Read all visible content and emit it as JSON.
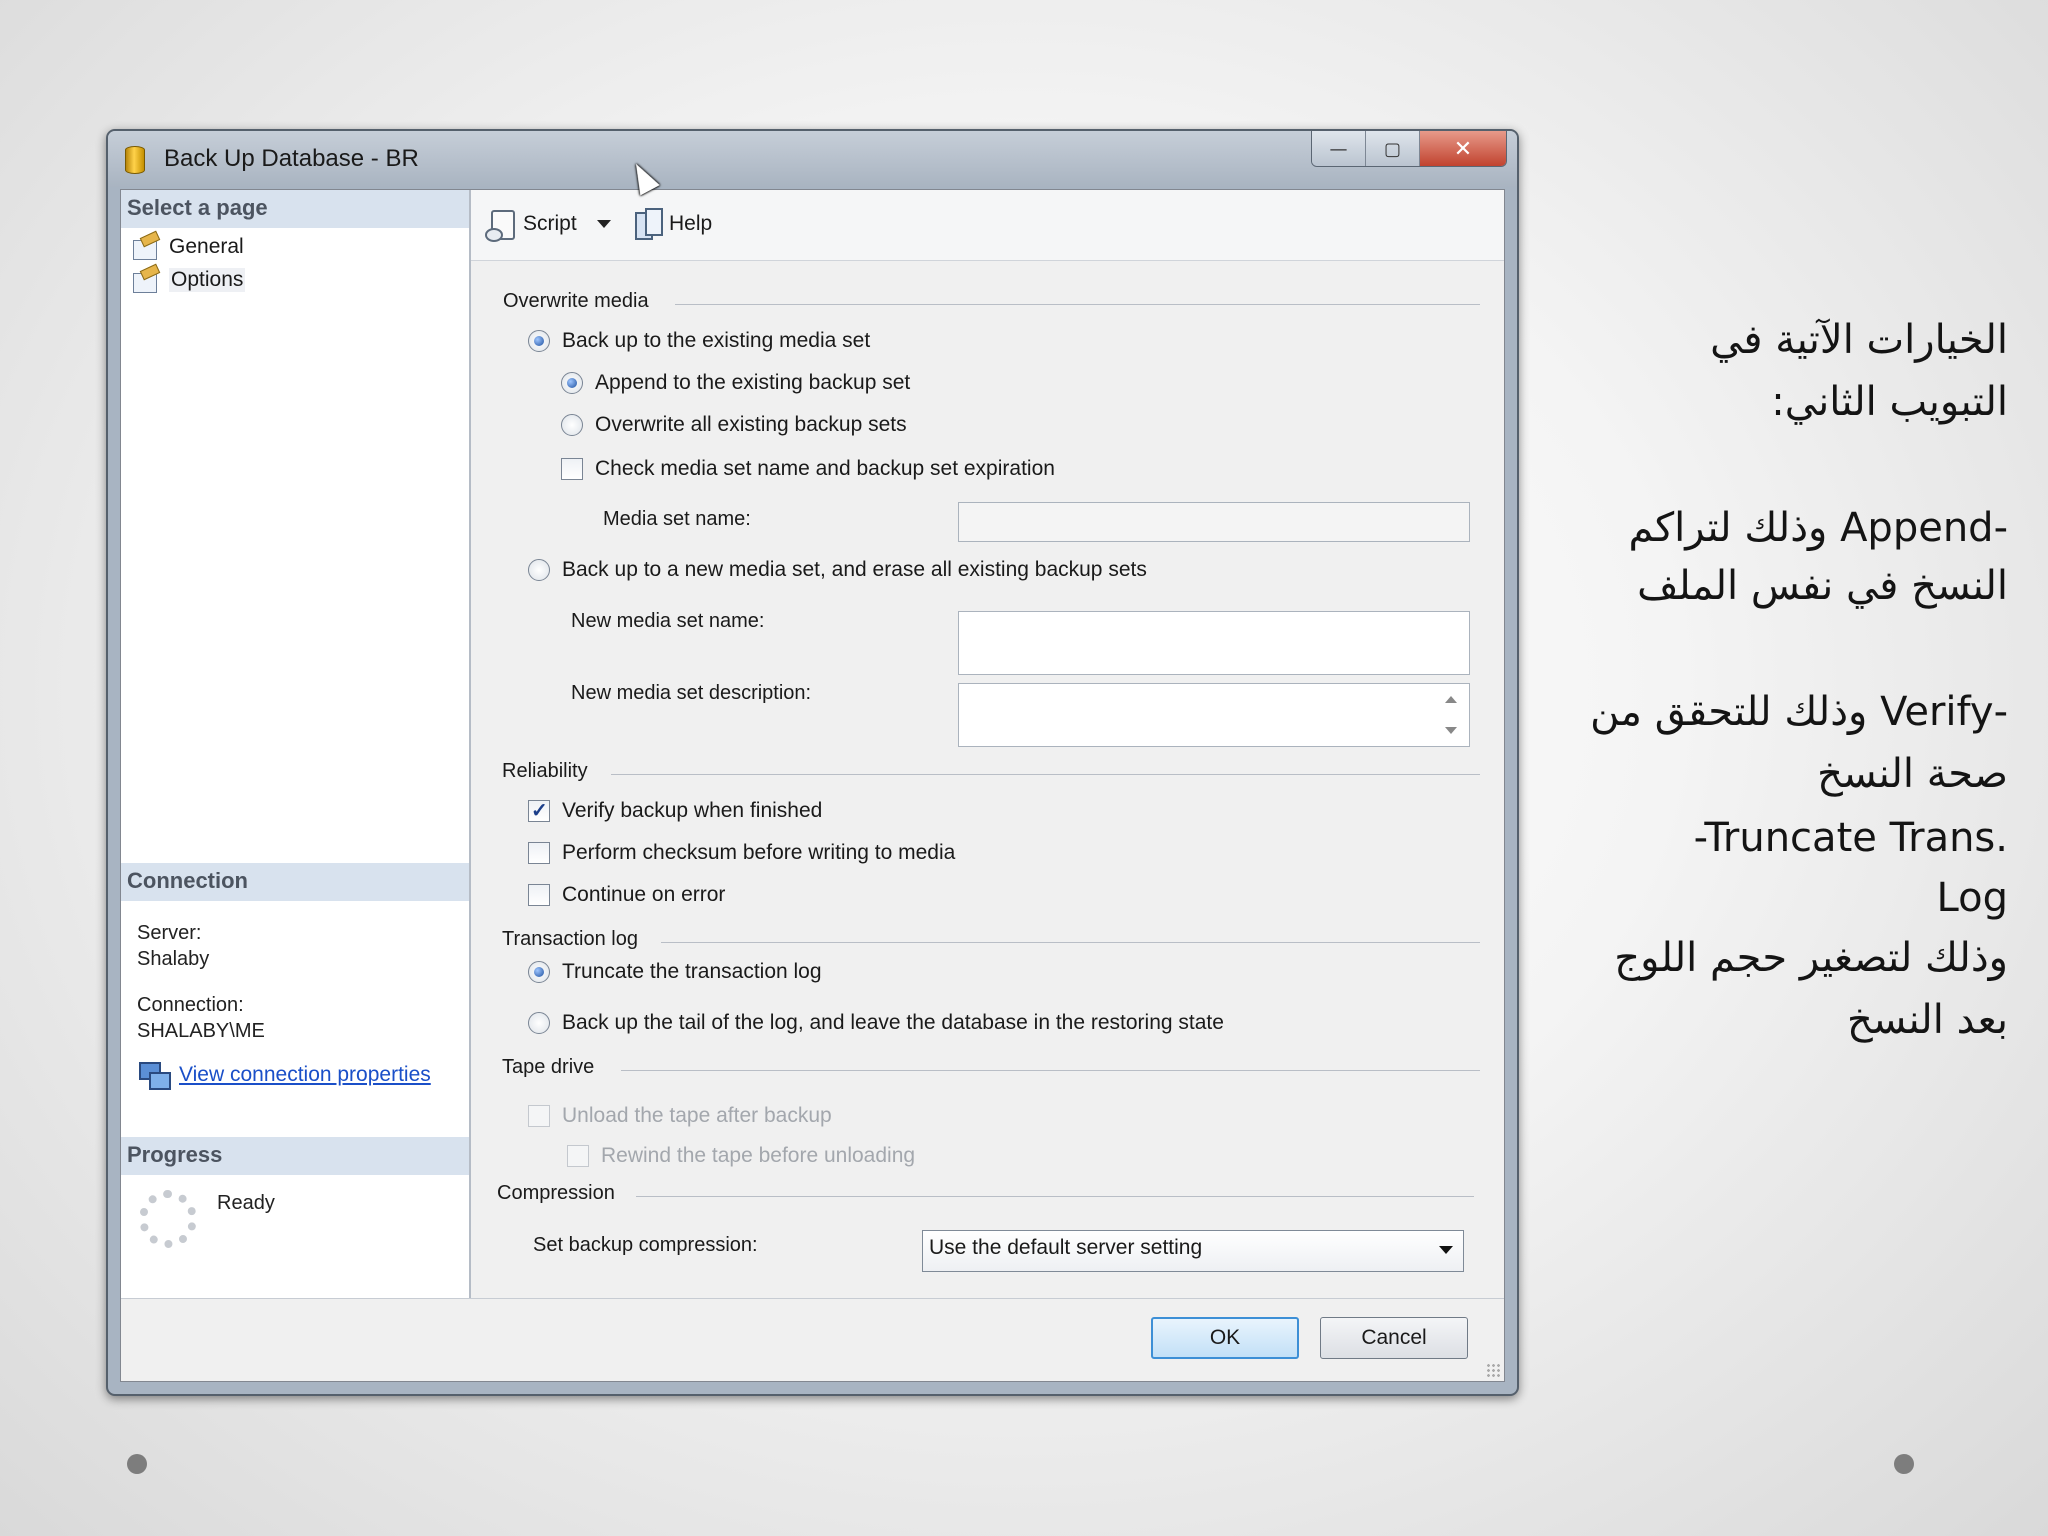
{
  "window": {
    "title": "Back Up Database - BR",
    "buttons": {
      "minimize": "—",
      "maximize": "▢",
      "close": "✕"
    }
  },
  "sidebar": {
    "select_page_header": "Select a page",
    "pages": [
      {
        "label": "General",
        "icon": "properties-page-icon"
      },
      {
        "label": "Options",
        "icon": "properties-page-icon",
        "selected": true
      }
    ],
    "connection_header": "Connection",
    "server_label": "Server:",
    "server_value": "Shalaby",
    "connection_label": "Connection:",
    "connection_value": "SHALABY\\ME",
    "view_connection_link": "View connection properties",
    "progress_header": "Progress",
    "progress_status": "Ready"
  },
  "toolbar": {
    "script_label": "Script",
    "help_label": "Help"
  },
  "options": {
    "overwrite_media": {
      "header": "Overwrite media",
      "existing_set_label": "Back up to the existing media set",
      "append_label": "Append to the existing backup set",
      "overwrite_label": "Overwrite all existing backup sets",
      "check_media_label": "Check media set name and backup set expiration",
      "media_set_name_label": "Media set name:",
      "media_set_name_value": "",
      "new_set_label": "Back up to a new media set, and erase all existing backup sets",
      "new_media_set_name_label": "New media set name:",
      "new_media_set_name_value": "",
      "new_media_set_description_label": "New media set description:",
      "new_media_set_description_value": ""
    },
    "reliability": {
      "header": "Reliability",
      "verify_label": "Verify backup when finished",
      "verify_checked": true,
      "checksum_label": "Perform checksum before writing to media",
      "checksum_checked": false,
      "continue_label": "Continue on error",
      "continue_checked": false
    },
    "transaction_log": {
      "header": "Transaction log",
      "truncate_label": "Truncate the transaction log",
      "tail_label": "Back up the tail of the log, and leave the database in the restoring state"
    },
    "tape_drive": {
      "header": "Tape drive",
      "unload_label": "Unload the tape after backup",
      "rewind_label": "Rewind the tape before unloading"
    },
    "compression": {
      "header": "Compression",
      "set_label": "Set backup compression:",
      "selected_value": "Use the default server setting"
    }
  },
  "footer": {
    "ok_label": "OK",
    "cancel_label": "Cancel"
  },
  "slide_notes": {
    "line1": "الخيارات الآتية في",
    "line2": "التبويب الثاني:",
    "line3": "-Append  وذلك لتراكم",
    "line4": "النسخ في نفس الملف",
    "line5": "-Verify وذلك للتحقق من",
    "line6": "صحة النسخ",
    "line7": "-Truncate Trans.",
    "line8": "Log",
    "line9": "وذلك لتصغير حجم اللوج",
    "line10": "بعد النسخ"
  }
}
